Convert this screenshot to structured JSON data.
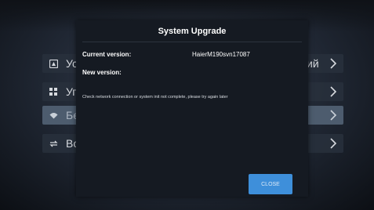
{
  "menu": {
    "items": [
      {
        "label_prefix": "Ус",
        "suffix": "ий",
        "icon": "monitor-icon",
        "selected": false
      },
      {
        "label_prefix": "Уг",
        "suffix": "",
        "icon": "grid-icon",
        "selected": false
      },
      {
        "label_prefix": "Бе",
        "suffix": "",
        "icon": "wifi-icon",
        "selected": true
      },
      {
        "label_prefix": "Во",
        "suffix": "",
        "icon": "refresh-icon",
        "selected": false
      }
    ]
  },
  "dialog": {
    "title": "System Upgrade",
    "current_version_label": "Current version:",
    "current_version_value": "HaierM190svn17087",
    "new_version_label": "New version:",
    "new_version_value": "",
    "message": "Check network connection or system init not complete, please try again later",
    "close_label": "CLOSE"
  },
  "colors": {
    "dialog_background": "#151a22",
    "accent_button": "#3e8fda",
    "selected_row": "#4d5c6e"
  }
}
